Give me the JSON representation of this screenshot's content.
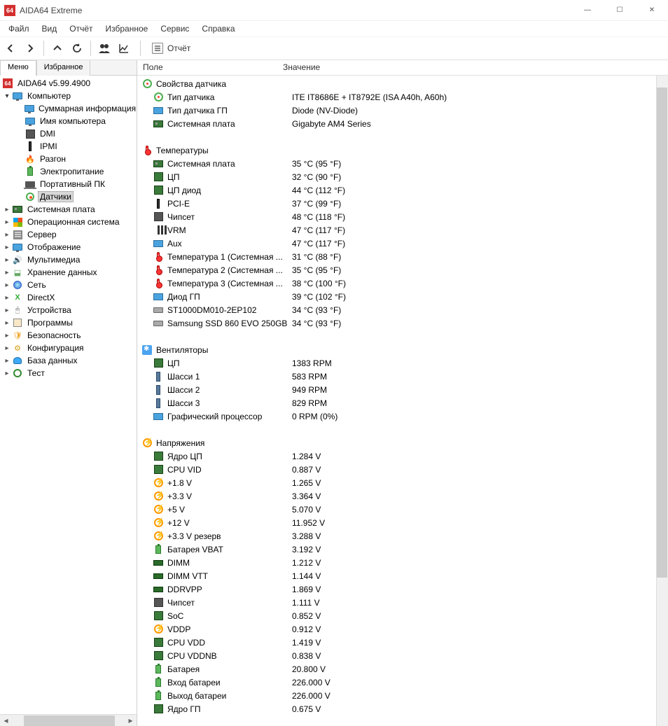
{
  "window": {
    "title": "AIDA64 Extreme",
    "icon_text": "64"
  },
  "win_controls": {
    "min": "—",
    "max": "☐",
    "close": "✕"
  },
  "menubar": [
    "Файл",
    "Вид",
    "Отчёт",
    "Избранное",
    "Сервис",
    "Справка"
  ],
  "toolbar": {
    "report_label": "Отчёт"
  },
  "sidebar": {
    "tabs": [
      "Меню",
      "Избранное"
    ],
    "root": "AIDA64 v5.99.4900",
    "computer": "Компьютер",
    "computer_children": [
      "Суммарная информация",
      "Имя компьютера",
      "DMI",
      "IPMI",
      "Разгон",
      "Электропитание",
      "Портативный ПК",
      "Датчики"
    ],
    "siblings": [
      "Системная плата",
      "Операционная система",
      "Сервер",
      "Отображение",
      "Мультимедиа",
      "Хранение данных",
      "Сеть",
      "DirectX",
      "Устройства",
      "Программы",
      "Безопасность",
      "Конфигурация",
      "База данных",
      "Тест"
    ]
  },
  "list_header": {
    "field": "Поле",
    "value": "Значение"
  },
  "groups": [
    {
      "title": "Свойства датчика",
      "icon": "sens",
      "rows": [
        {
          "icon": "sens",
          "f": "Тип датчика",
          "v": "ITE IT8686E + IT8792E  (ISA A40h, A60h)"
        },
        {
          "icon": "gpu",
          "f": "Тип датчика ГП",
          "v": "Diode  (NV-Diode)"
        },
        {
          "icon": "board",
          "f": "Системная плата",
          "v": "Gigabyte AM4 Series"
        }
      ]
    },
    {
      "title": "Температуры",
      "icon": "therm",
      "rows": [
        {
          "icon": "board",
          "f": "Системная плата",
          "v": "35 °C  (95 °F)"
        },
        {
          "icon": "cpu",
          "f": "ЦП",
          "v": "32 °C  (90 °F)"
        },
        {
          "icon": "cpu",
          "f": "ЦП диод",
          "v": "44 °C  (112 °F)"
        },
        {
          "icon": "pcie",
          "f": "PCI-E",
          "v": "37 °C  (99 °F)"
        },
        {
          "icon": "chip",
          "f": "Чипсет",
          "v": "48 °C  (118 °F)"
        },
        {
          "icon": "vrm",
          "f": "VRM",
          "v": "47 °C  (117 °F)"
        },
        {
          "icon": "gpu",
          "f": "Aux",
          "v": "47 °C  (117 °F)"
        },
        {
          "icon": "therm",
          "f": "Температура 1 (Системная ...",
          "v": "31 °C  (88 °F)"
        },
        {
          "icon": "therm",
          "f": "Температура 2 (Системная ...",
          "v": "35 °C  (95 °F)"
        },
        {
          "icon": "therm",
          "f": "Температура 3 (Системная ...",
          "v": "38 °C  (100 °F)"
        },
        {
          "icon": "gpu",
          "f": "Диод ГП",
          "v": "39 °C  (102 °F)"
        },
        {
          "icon": "hdd",
          "f": "ST1000DM010-2EP102",
          "v": "34 °C  (93 °F)"
        },
        {
          "icon": "hdd",
          "f": "Samsung SSD 860 EVO 250GB",
          "v": "34 °C  (93 °F)"
        }
      ]
    },
    {
      "title": "Вентиляторы",
      "icon": "fan",
      "rows": [
        {
          "icon": "cpu",
          "f": "ЦП",
          "v": "1383 RPM"
        },
        {
          "icon": "chassis",
          "f": "Шасси 1",
          "v": "583 RPM"
        },
        {
          "icon": "chassis",
          "f": "Шасси 2",
          "v": "949 RPM"
        },
        {
          "icon": "chassis",
          "f": "Шасси 3",
          "v": "829 RPM"
        },
        {
          "icon": "gpu",
          "f": "Графический процессор",
          "v": "0 RPM  (0%)"
        }
      ]
    },
    {
      "title": "Напряжения",
      "icon": "volt",
      "rows": [
        {
          "icon": "cpu",
          "f": "Ядро ЦП",
          "v": "1.284 V"
        },
        {
          "icon": "cpu",
          "f": "CPU VID",
          "v": "0.887 V"
        },
        {
          "icon": "volt",
          "f": "+1.8 V",
          "v": "1.265 V"
        },
        {
          "icon": "volt",
          "f": "+3.3 V",
          "v": "3.364 V"
        },
        {
          "icon": "volt",
          "f": "+5 V",
          "v": "5.070 V"
        },
        {
          "icon": "volt",
          "f": "+12 V",
          "v": "11.952 V"
        },
        {
          "icon": "volt",
          "f": "+3.3 V резерв",
          "v": "3.288 V"
        },
        {
          "icon": "batt",
          "f": "Батарея VBAT",
          "v": "3.192 V"
        },
        {
          "icon": "ram",
          "f": "DIMM",
          "v": "1.212 V"
        },
        {
          "icon": "ram",
          "f": "DIMM VTT",
          "v": "1.144 V"
        },
        {
          "icon": "ram",
          "f": "DDRVPP",
          "v": "1.869 V"
        },
        {
          "icon": "chip",
          "f": "Чипсет",
          "v": "1.111 V"
        },
        {
          "icon": "cpu",
          "f": "SoC",
          "v": "0.852 V"
        },
        {
          "icon": "volt",
          "f": "VDDP",
          "v": "0.912 V"
        },
        {
          "icon": "cpu",
          "f": "CPU VDD",
          "v": "1.419 V"
        },
        {
          "icon": "cpu",
          "f": "CPU VDDNB",
          "v": "0.838 V"
        },
        {
          "icon": "batt",
          "f": "Батарея",
          "v": "20.800 V"
        },
        {
          "icon": "batt",
          "f": "Вход батареи",
          "v": "226.000 V"
        },
        {
          "icon": "batt",
          "f": "Выход батареи",
          "v": "226.000 V"
        },
        {
          "icon": "cpu",
          "f": "Ядро ГП",
          "v": "0.675 V"
        }
      ]
    }
  ]
}
